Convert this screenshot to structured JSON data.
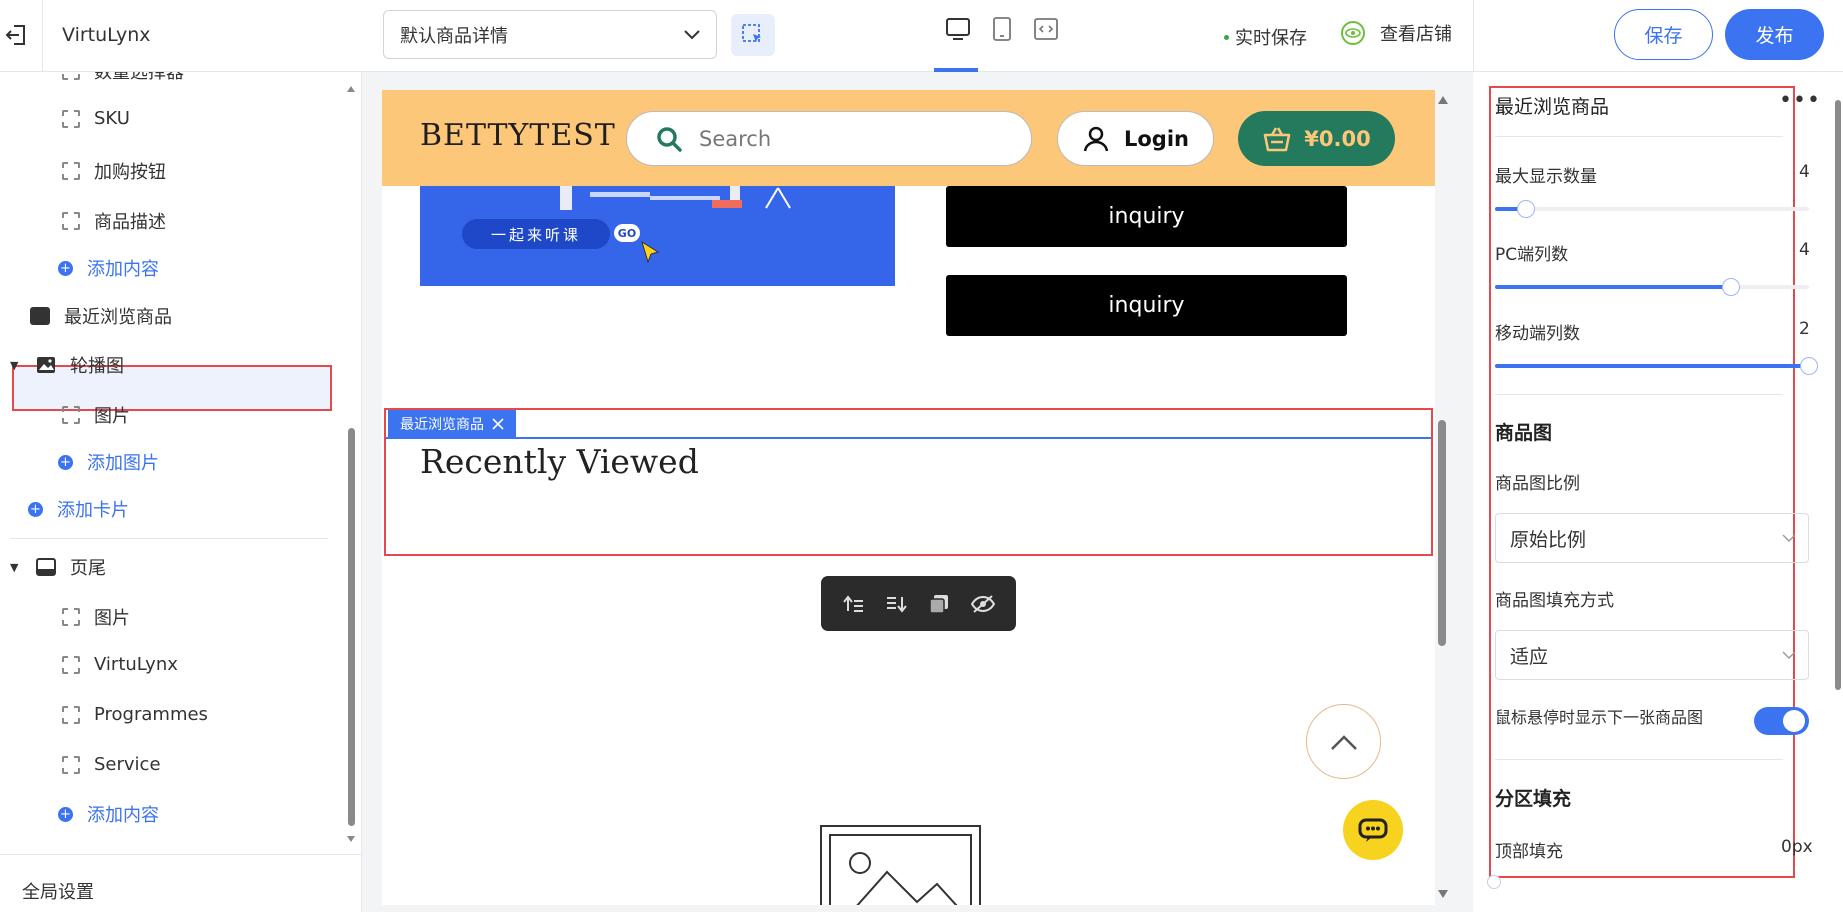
{
  "topbar": {
    "app_name": "VirtuLynx",
    "template_select": "默认商品详情",
    "live_save": "实时保存",
    "view_store": "查看店铺",
    "save": "保存",
    "publish": "发布"
  },
  "sidebar": {
    "items": [
      {
        "label": "数量选择器",
        "type": "block"
      },
      {
        "label": "SKU",
        "type": "block"
      },
      {
        "label": "加购按钮",
        "type": "block"
      },
      {
        "label": "商品描述",
        "type": "block"
      },
      {
        "label": "添加内容",
        "type": "add"
      },
      {
        "label": "最近浏览商品",
        "type": "section"
      },
      {
        "label": "轮播图",
        "type": "section"
      },
      {
        "label": "图片",
        "type": "block"
      },
      {
        "label": "添加图片",
        "type": "add"
      },
      {
        "label": "添加卡片",
        "type": "add"
      },
      {
        "label": "页尾",
        "type": "section"
      },
      {
        "label": "图片",
        "type": "block"
      },
      {
        "label": "VirtuLynx",
        "type": "block"
      },
      {
        "label": "Programmes",
        "type": "block"
      },
      {
        "label": "Service",
        "type": "block"
      },
      {
        "label": "添加内容",
        "type": "add"
      }
    ],
    "global_settings": "全局设置"
  },
  "preview": {
    "brand": "BETTYTEST",
    "search_placeholder": "Search",
    "login": "Login",
    "cart_total": "¥0.00",
    "banner_pill": "一起来听课",
    "banner_go": "GO",
    "inquiry_1": "inquiry",
    "inquiry_2": "inquiry",
    "section_tag": "最近浏览商品",
    "section_title": "Recently Viewed"
  },
  "panel": {
    "title": "最近浏览商品",
    "max_count_label": "最大显示数量",
    "max_count_value": "4",
    "max_count_fraction": 0.1,
    "pc_cols_label": "PC端列数",
    "pc_cols_value": "4",
    "pc_cols_fraction": 0.75,
    "mobile_cols_label": "移动端列数",
    "mobile_cols_value": "2",
    "mobile_cols_fraction": 1.0,
    "image_heading": "商品图",
    "ratio_label": "商品图比例",
    "ratio_value": "原始比例",
    "fill_label": "商品图填充方式",
    "fill_value": "适应",
    "hover_label": "鼠标悬停时显示下一张商品图",
    "hover_enabled": true,
    "section_fill_heading": "分区填充",
    "top_padding_label": "顶部填充",
    "top_padding_value": "0px"
  },
  "colors": {
    "accent": "#3b73f0",
    "selection": "#e5484d",
    "header_bg": "#fdc779",
    "cart_bg": "#247a5c"
  }
}
